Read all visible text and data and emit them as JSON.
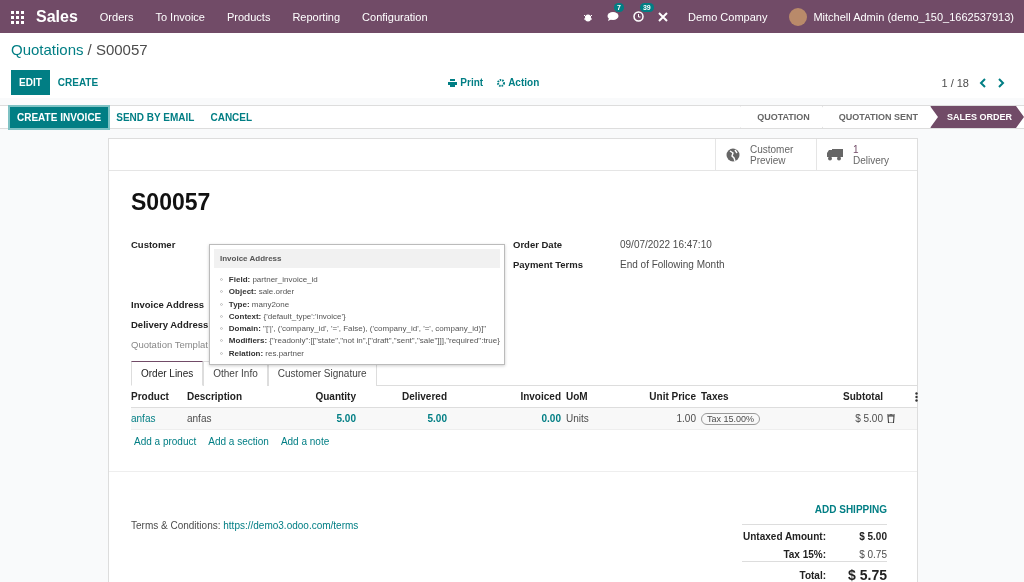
{
  "navbar": {
    "app": "Sales",
    "menu": [
      "Orders",
      "To Invoice",
      "Products",
      "Reporting",
      "Configuration"
    ],
    "messages_badge": "7",
    "activities_badge": "39",
    "company": "Demo Company",
    "user": "Mitchell Admin (demo_150_1662537913)"
  },
  "breadcrumb": {
    "parent": "Quotations",
    "current": "/ S00057"
  },
  "control_panel": {
    "buttons": [
      {
        "label": "EDIT",
        "kind": "primary"
      },
      {
        "label": "CREATE",
        "kind": "link"
      }
    ],
    "print": "Print",
    "action": "Action",
    "pager": "1 / 18"
  },
  "statusbar": {
    "buttons": [
      {
        "label": "CREATE INVOICE",
        "kind": "primary"
      },
      {
        "label": "SEND BY EMAIL",
        "kind": "link"
      },
      {
        "label": "CANCEL",
        "kind": "link"
      }
    ],
    "stages": [
      {
        "label": "QUOTATION",
        "selected": false
      },
      {
        "label": "QUOTATION SENT",
        "selected": false
      },
      {
        "label": "SALES ORDER",
        "selected": true
      }
    ]
  },
  "smart_buttons": [
    {
      "kind": "globe",
      "label": "Customer",
      "label2": "Preview"
    },
    {
      "kind": "truck",
      "count": "1",
      "label": "Delivery"
    }
  ],
  "title": "S00057",
  "left_fields": [
    {
      "label": "Customer",
      "kind": "bold"
    },
    {
      "label": "Invoice Address",
      "kind": "bold"
    },
    {
      "label": "Delivery Address",
      "kind": "bold"
    },
    {
      "label": "Quotation Templat",
      "kind": "muted"
    }
  ],
  "right_fields": [
    {
      "label": "Order Date",
      "value": "09/07/2022 16:47:10"
    },
    {
      "label": "Payment Terms",
      "value": "End of Following Month"
    }
  ],
  "tooltip": {
    "title": "Invoice Address",
    "bullet": "◦",
    "items": [
      {
        "key": "Field:",
        "value": "partner_invoice_id"
      },
      {
        "key": "Object:",
        "value": "sale.order"
      },
      {
        "key": "Type:",
        "value": "many2one"
      },
      {
        "key": "Context:",
        "value": "{'default_type':'invoice'}"
      },
      {
        "key": "Domain:",
        "value": "\"['|', ('company_id', '=', False), ('company_id', '=', company_id)]\""
      },
      {
        "key": "Modifiers:",
        "value": "{\"readonly\":[[\"state\",\"not in\",[\"draft\",\"sent\",\"sale\"]]],\"required\":true}"
      },
      {
        "key": "Relation:",
        "value": "res.partner"
      }
    ]
  },
  "tabs": [
    {
      "label": "Order Lines",
      "selected": true
    },
    {
      "label": "Other Info",
      "selected": false
    },
    {
      "label": "Customer Signature",
      "selected": false
    }
  ],
  "table": {
    "columns": [
      "Product",
      "Description",
      "Quantity",
      "Delivered",
      "Invoiced",
      "UoM",
      "Unit Price",
      "Taxes",
      "Subtotal"
    ],
    "rows": [
      {
        "product": "anfas",
        "description": "anfas",
        "quantity": "5.00",
        "delivered": "5.00",
        "invoiced": "0.00",
        "uom": "Units",
        "unit_price": "1.00",
        "tax": "Tax 15.00%",
        "subtotal": "$ 5.00"
      }
    ],
    "add_links": [
      "Add a product",
      "Add a section",
      "Add a note"
    ]
  },
  "terms": {
    "label": "Terms & Conditions:",
    "link": "https://demo3.odoo.com/terms"
  },
  "add_shipping": "ADD SHIPPING",
  "totals": [
    {
      "label": "Untaxed Amount:",
      "value": "$ 5.00",
      "kind": "bold"
    },
    {
      "label": "Tax 15%:",
      "value": "$ 0.75",
      "kind": "plain"
    },
    {
      "label": "Total:",
      "value": "$ 5.75",
      "kind": "total"
    }
  ]
}
